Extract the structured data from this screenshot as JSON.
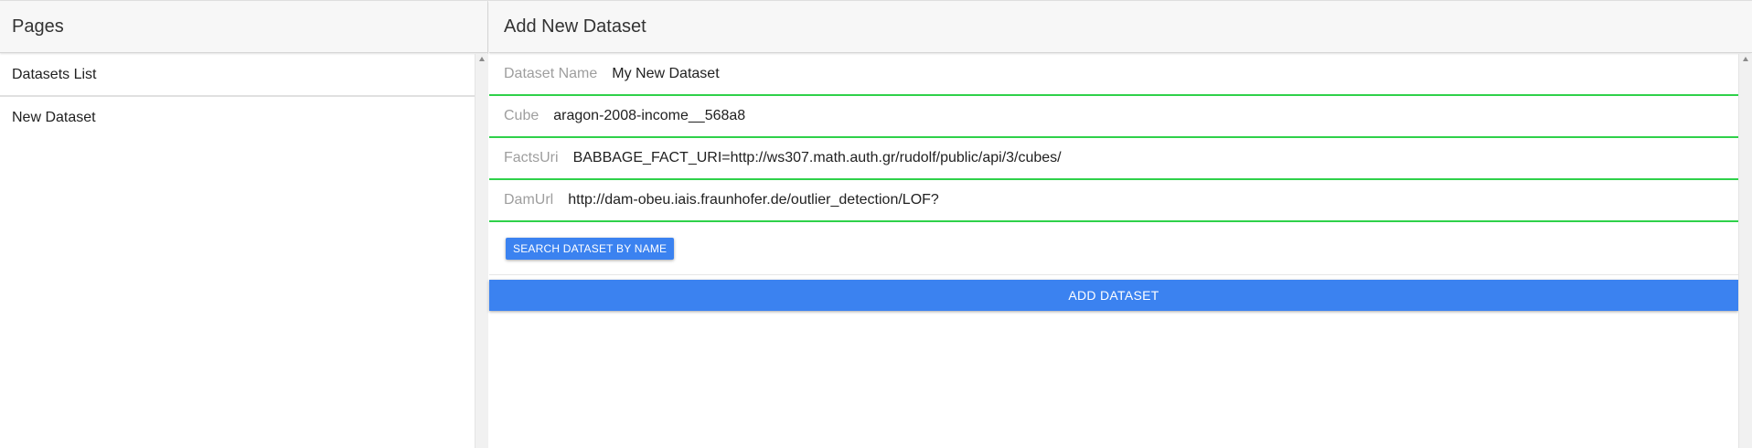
{
  "sidebar": {
    "title": "Pages",
    "items": [
      {
        "label": "Datasets List"
      },
      {
        "label": "New Dataset"
      }
    ]
  },
  "main": {
    "title": "Add New Dataset",
    "fields": [
      {
        "label": "Dataset Name",
        "value": "My New Dataset"
      },
      {
        "label": "Cube",
        "value": "aragon-2008-income__568a8"
      },
      {
        "label": "FactsUri",
        "value": "BABBAGE_FACT_URI=http://ws307.math.auth.gr/rudolf/public/api/3/cubes/"
      },
      {
        "label": "DamUrl",
        "value": "http://dam-obeu.iais.fraunhofer.de/outlier_detection/LOF?"
      }
    ],
    "search_button": "SEARCH DATASET BY NAME",
    "add_button": "ADD DATASET"
  },
  "colors": {
    "accent": "#3b82f0",
    "field_underline": "#2fd14a"
  }
}
